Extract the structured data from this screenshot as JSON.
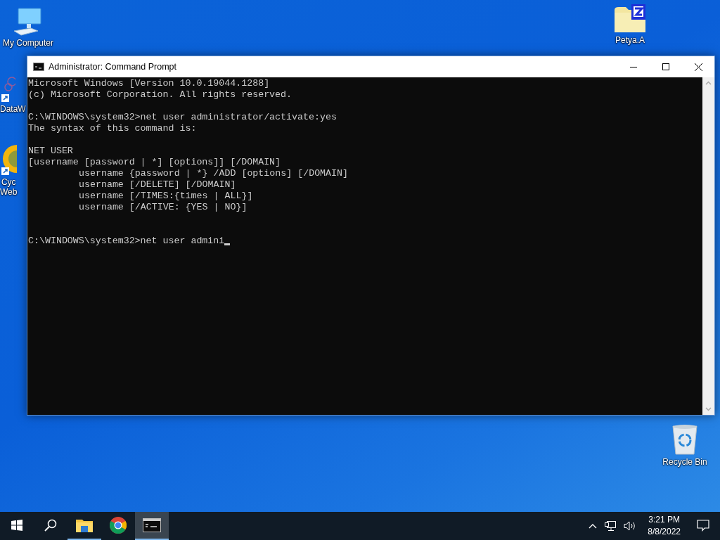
{
  "desktop_icons": [
    {
      "label": "My Computer",
      "kind": "computer"
    },
    {
      "label": "DataW",
      "kind": "shortcut-data"
    },
    {
      "label": "Cyc\nWeb",
      "kind": "shortcut-globe"
    },
    {
      "label": "Petya.A",
      "kind": "archive"
    },
    {
      "label": "Recycle Bin",
      "kind": "bin"
    }
  ],
  "window": {
    "title": "Administrator: Command Prompt",
    "console": [
      {
        "kind": "text",
        "text": "Microsoft Windows [Version 10.0.19044.1288]",
        "indented": false
      },
      {
        "kind": "text",
        "text": "(c) Microsoft Corporation. All rights reserved.",
        "indented": false
      },
      {
        "kind": "blank"
      },
      {
        "kind": "text",
        "text": "C:\\WINDOWS\\system32>net user administrator/activate:yes",
        "indented": false
      },
      {
        "kind": "text",
        "text": "The syntax of this command is:",
        "indented": false
      },
      {
        "kind": "blank"
      },
      {
        "kind": "text",
        "text": "NET USER",
        "indented": false
      },
      {
        "kind": "text",
        "text": "[username [password | *] [options]] [/DOMAIN]",
        "indented": false
      },
      {
        "kind": "text",
        "text": "username {password | *} /ADD [options] [/DOMAIN]",
        "indented": true
      },
      {
        "kind": "text",
        "text": "username [/DELETE] [/DOMAIN]",
        "indented": true
      },
      {
        "kind": "text",
        "text": "username [/TIMES:{times | ALL}]",
        "indented": true
      },
      {
        "kind": "text",
        "text": "username [/ACTIVE: {YES | NO}]",
        "indented": true
      },
      {
        "kind": "blank"
      },
      {
        "kind": "blank"
      },
      {
        "kind": "text",
        "text": "C:\\WINDOWS\\system32>net user admini",
        "indented": false,
        "cursor": true
      }
    ]
  },
  "taskbar": {
    "apps": [
      {
        "kind": "explorer",
        "running": true,
        "selected": false
      },
      {
        "kind": "chrome",
        "running": false,
        "selected": false
      },
      {
        "kind": "terminal",
        "running": true,
        "selected": true
      }
    ],
    "time": "3:21 PM",
    "date": "8/8/2022"
  }
}
